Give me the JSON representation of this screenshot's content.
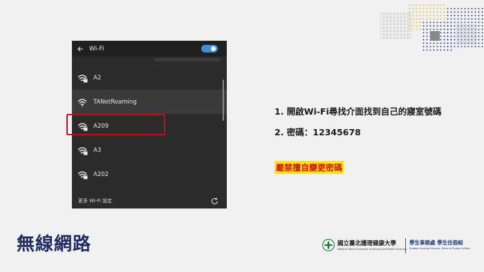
{
  "wifi_panel": {
    "header_title": "Wi-Fi",
    "toggle_on": true,
    "networks": [
      {
        "ssid": "A2",
        "secured": true
      },
      {
        "ssid": "TANetRoaming",
        "secured": false
      },
      {
        "ssid": "A209",
        "secured": true
      },
      {
        "ssid": "A3",
        "secured": true
      },
      {
        "ssid": "A202",
        "secured": true
      }
    ],
    "footer_label": "更多 Wi-Fi 設定",
    "accent_color": "#3a8fe0",
    "highlight_color": "#b3131e"
  },
  "instructions": {
    "step1": "1.  開啟Wi-Fi尋找介面找到自己的寢室號碼",
    "step2": "2.  密碼：12345678",
    "warning": "嚴禁擅自變更密碼"
  },
  "page_title": "無線網路",
  "branding": {
    "university_name": "國立臺北護理健康大學",
    "university_name_en": "National Taipei University of Nursing and Health Sciences",
    "department_name": "學生事務處 學生住宿組",
    "department_name_en": "Student Housing Division, Office of Student Affairs"
  },
  "colors": {
    "title": "#1f2b63",
    "warning_bg": "#ffe800",
    "warning_text": "#d0121b"
  }
}
